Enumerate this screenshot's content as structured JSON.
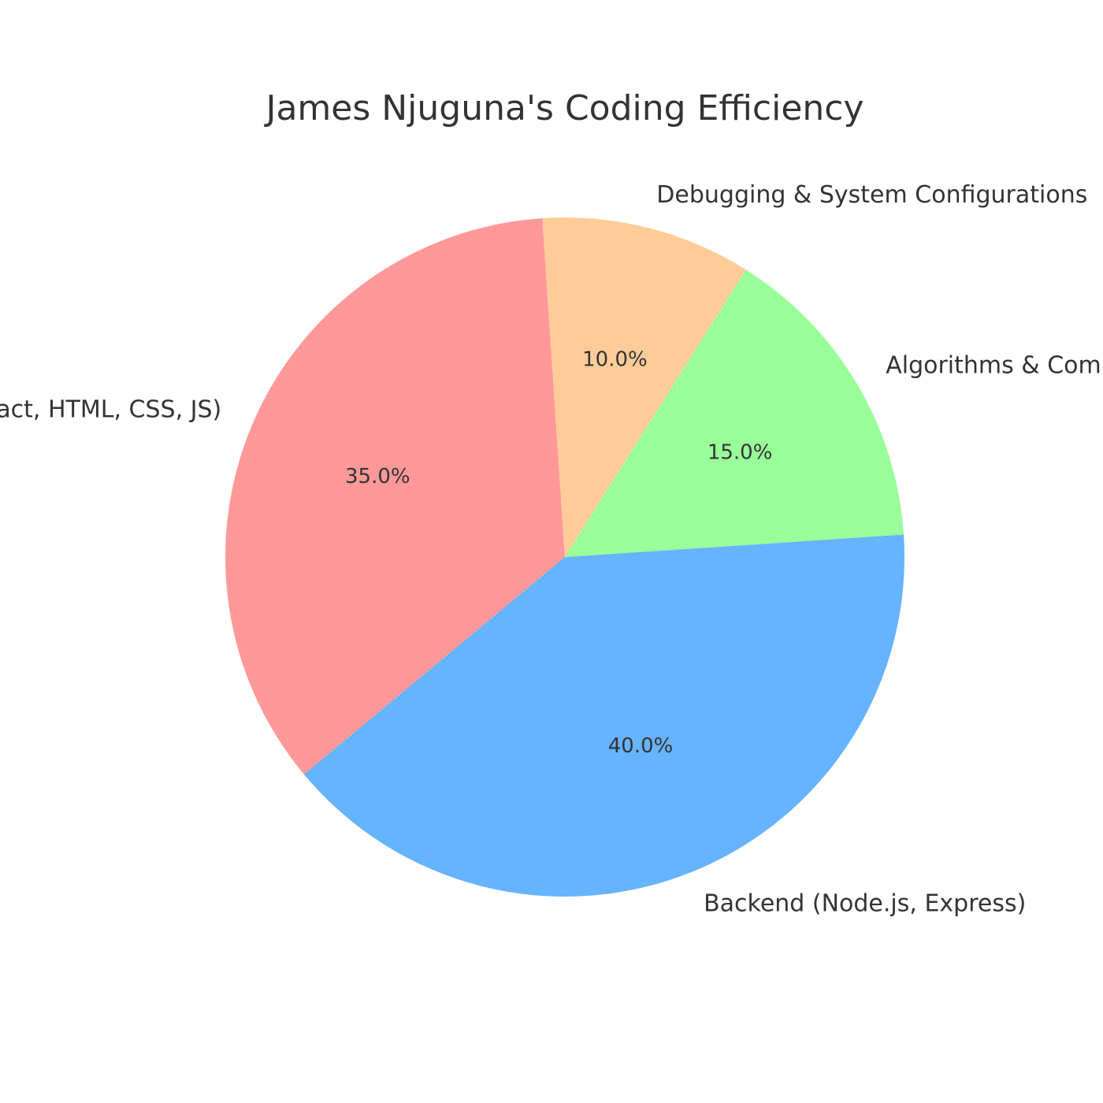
{
  "chart_data": {
    "type": "pie",
    "title": "James Njuguna's Coding Efficiency",
    "start_angle_deg": 93.8,
    "direction": "counterclockwise",
    "slices": [
      {
        "label": "Frontend (React, HTML, CSS, JS)",
        "value": 35.0,
        "pct_label": "35.0%",
        "color": "#ff9999"
      },
      {
        "label": "Backend (Node.js, Express)",
        "value": 40.0,
        "pct_label": "40.0%",
        "color": "#66b3ff"
      },
      {
        "label": "Algorithms & Computation",
        "value": 15.0,
        "pct_label": "15.0%",
        "color": "#99ff99"
      },
      {
        "label": "Debugging & System Configurations",
        "value": 10.0,
        "pct_label": "10.0%",
        "color": "#ffcc99"
      }
    ]
  }
}
